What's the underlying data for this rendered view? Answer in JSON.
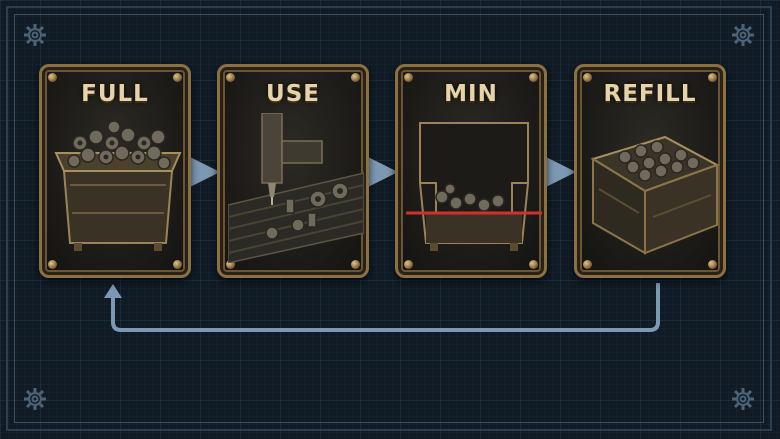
{
  "steps": [
    {
      "label": "FULL"
    },
    {
      "label": "USE"
    },
    {
      "label": "MIN"
    },
    {
      "label": "REFILL"
    }
  ],
  "icons": {
    "full": "full-bin-icon",
    "use": "machining-table-icon",
    "min": "min-level-bin-icon",
    "refill": "refilled-crate-icon",
    "corner": "gear-icon"
  },
  "colors": {
    "background": "#101b26",
    "card_border": "#8a7042",
    "title_text": "#e6d3a8",
    "arrow": "#7d98b3",
    "min_line": "#d2302a"
  }
}
